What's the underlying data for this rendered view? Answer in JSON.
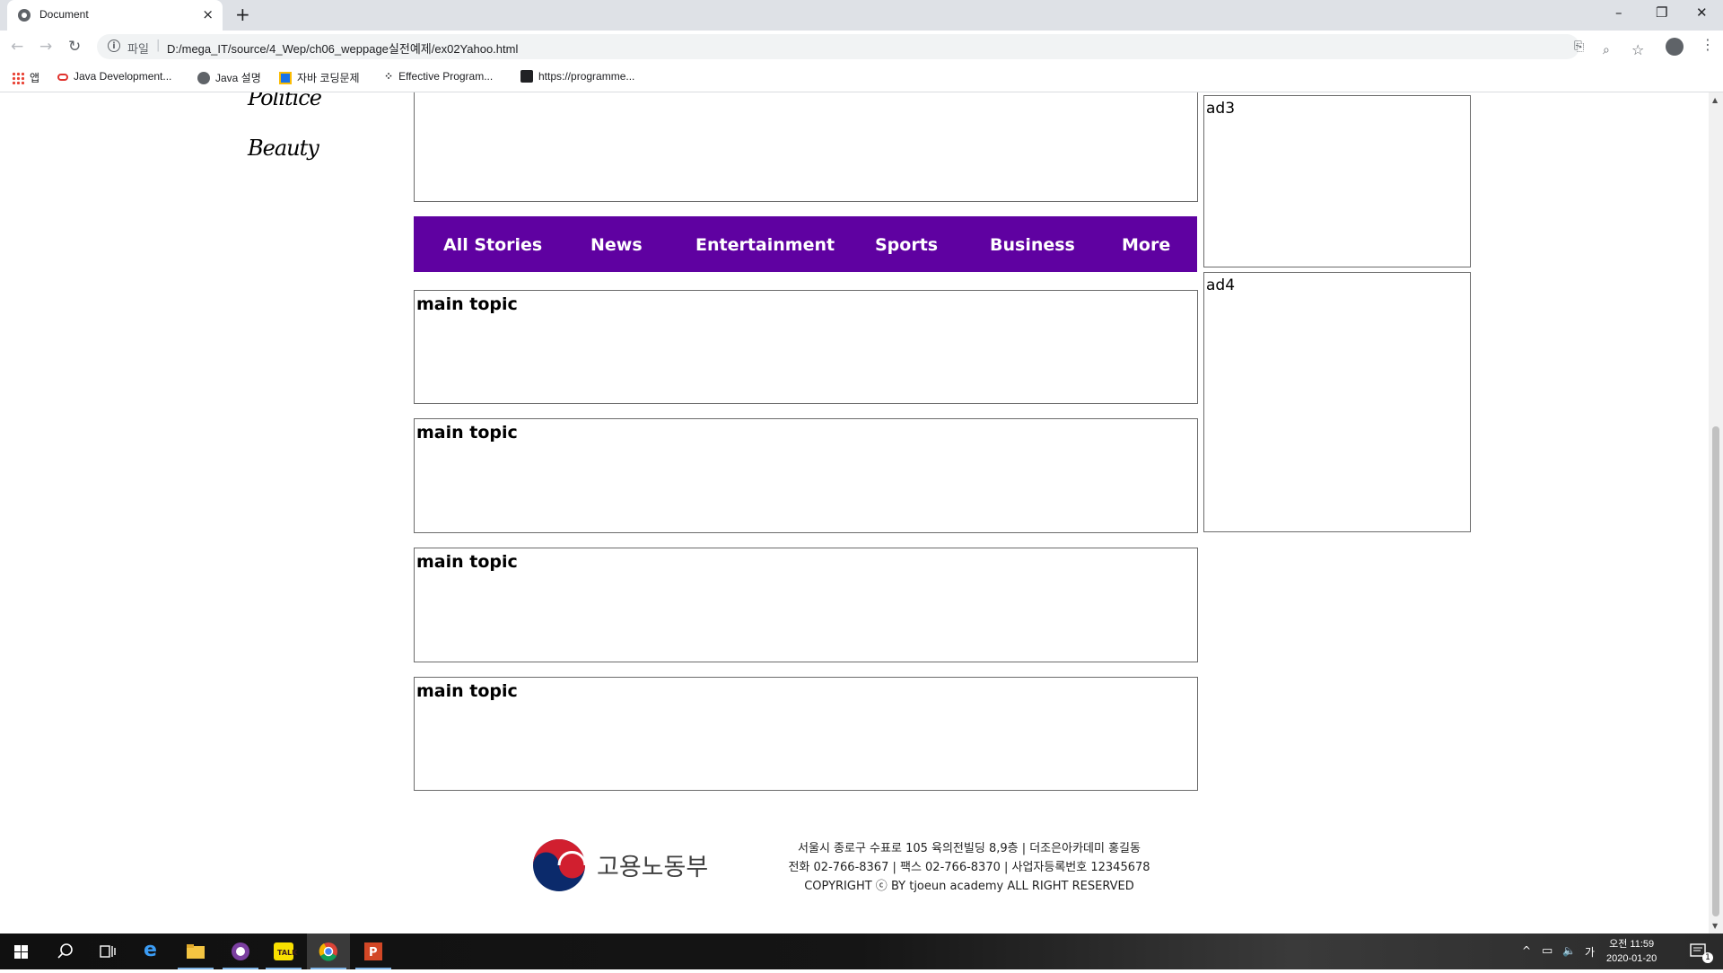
{
  "browser": {
    "tab_title": "Document",
    "tab_close": "×",
    "new_tab": "+",
    "window_controls": {
      "minimize": "–",
      "maximize": "❐",
      "close": "✕"
    },
    "nav": {
      "back": "←",
      "forward": "→",
      "reload": "↻"
    },
    "address": {
      "info_icon": "i",
      "scheme_label": "파일",
      "separator": "|",
      "url": "D:/mega_IT/source/4_Wep/ch06_weppage실전예제/ex02Yahoo.html"
    },
    "toolbar_icons": {
      "translate": "⎘",
      "zoom": "⌕",
      "star": "☆",
      "menu": "⋮"
    },
    "bookmarks": [
      {
        "label": "앱",
        "icon": "apps-grid-icon"
      },
      {
        "label": "Java Development...",
        "icon": "oracle-icon"
      },
      {
        "label": "Java 설명",
        "icon": "globe-icon"
      },
      {
        "label": "자바 코딩문제",
        "icon": "bookmark-page-icon"
      },
      {
        "label": "Effective Program...",
        "icon": "dots-icon"
      },
      {
        "label": "https://programme...",
        "icon": "programmers-icon"
      }
    ]
  },
  "page": {
    "side_links": [
      "Politice",
      "Beauty"
    ],
    "ads": [
      "ad3",
      "ad4"
    ],
    "navbar": [
      "All Stories",
      "News",
      "Entertainment",
      "Sports",
      "Business",
      "More"
    ],
    "topics": [
      "main topic",
      "main topic",
      "main topic",
      "main topic"
    ],
    "footer": {
      "logo_text": "고용노동부",
      "lines": [
        "서울시 종로구 수표로 105 육의전빌딩 8,9층 | 더조은아카데미 홍길동",
        "전화 02-766-8367 | 팩스 02-766-8370 | 사업자등록번호 12345678",
        "COPYRIGHT ⓒ BY tjoeun academy ALL RIGHT RESERVED"
      ]
    }
  },
  "colors": {
    "navbar_bg": "#5f01a1",
    "navbar_text": "#ffffff"
  },
  "taskbar": {
    "apps": [
      "start-icon",
      "search-icon",
      "task-view-icon",
      "edge-icon",
      "file-explorer-icon",
      "app-purple-icon",
      "kakaotalk-icon",
      "chrome-icon",
      "powerpoint-icon"
    ],
    "tray": {
      "chevron": "^",
      "ime": "가"
    },
    "clock_time": "오전 11:59",
    "clock_date": "2020-01-20",
    "notification_count": "1"
  }
}
